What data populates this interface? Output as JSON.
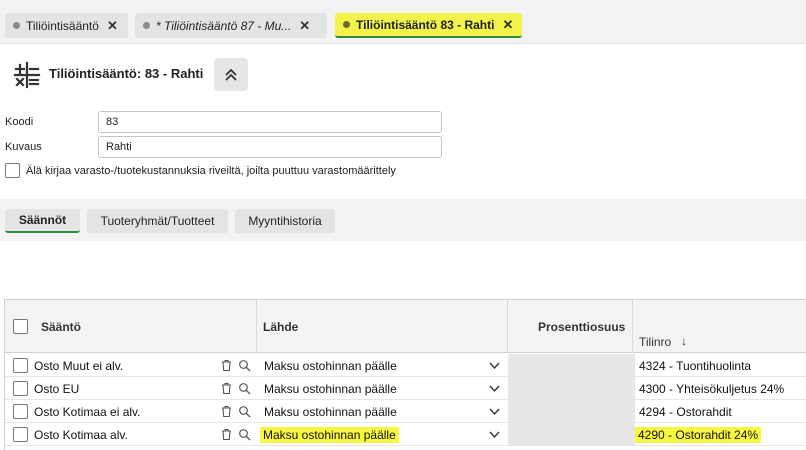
{
  "tabs": [
    {
      "label": "Tiliöintisääntö",
      "close": "✕"
    },
    {
      "label": "* Tiliöintisääntö 87 - Mu...",
      "close": "✕"
    },
    {
      "label": "Tiliöintisääntö 83 - Rahti",
      "close": "✕"
    }
  ],
  "header": {
    "title": "Tiliöintisääntö: 83 - Rahti",
    "icon": "calculator-icon",
    "collapse_icon": "chevron-up-double-icon"
  },
  "form": {
    "koodi_label": "Koodi",
    "koodi_value": "83",
    "kuvaus_label": "Kuvaus",
    "kuvaus_value": "Rahti",
    "checkbox_label": "Älä kirjaa varasto-/tuotekustannuksia riveiltä, joilta puuttuu varastomäärittely"
  },
  "subtabs": [
    {
      "label": "Säännöt"
    },
    {
      "label": "Tuoteryhmät/Tuotteet"
    },
    {
      "label": "Myyntihistoria"
    }
  ],
  "grid": {
    "columns": {
      "saanto": "Sääntö",
      "lahde": "Lähde",
      "prosentti": "Prosenttiosuus",
      "tilinro": "Tilinro",
      "sort_indicator": "↓"
    },
    "rows": [
      {
        "saanto": "Osto Muut ei alv.",
        "lahde": "Maksu ostohinnan päälle",
        "tilinro": "4324 - Tuontihuolinta"
      },
      {
        "saanto": "Osto EU",
        "lahde": "Maksu ostohinnan päälle",
        "tilinro": "4300 - Yhteisökuljetus 24%"
      },
      {
        "saanto": "Osto Kotimaa ei alv.",
        "lahde": "Maksu ostohinnan päälle",
        "tilinro": "4294 - Ostorahdit"
      },
      {
        "saanto": "Osto Kotimaa alv.",
        "lahde": "Maksu ostohinnan päälle",
        "tilinro": "4290 - Ostorahdit 24%"
      }
    ]
  },
  "colors": {
    "highlight": "#f7f741",
    "active_underline": "#2e8b3a"
  }
}
